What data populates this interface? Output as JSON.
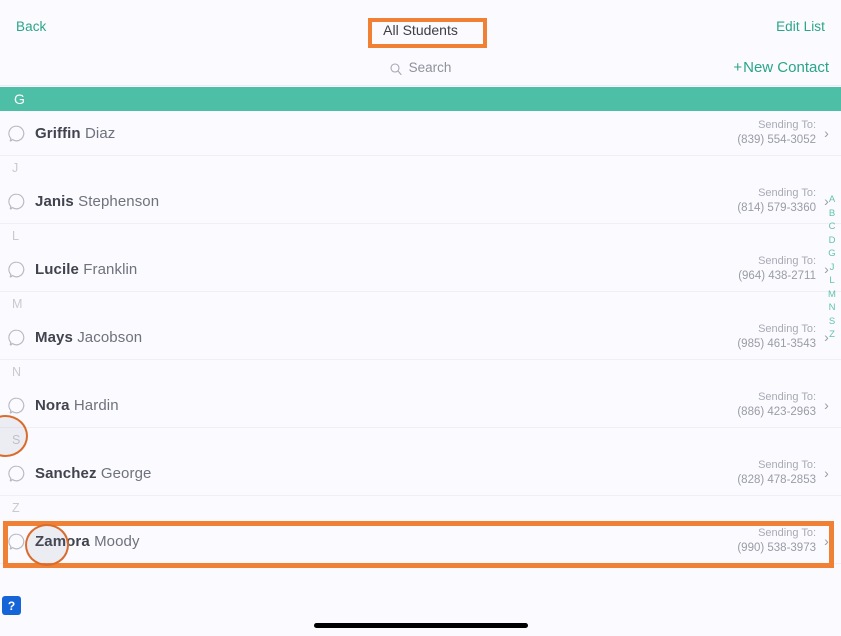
{
  "navbar": {
    "back_label": "Back",
    "title": "All Students",
    "edit_label": "Edit List"
  },
  "search": {
    "placeholder": "Search",
    "icon": "search-icon",
    "new_contact_plus": "+",
    "new_contact_label": "New Contact"
  },
  "list": {
    "band_letter": "G",
    "sending_label": "Sending To:",
    "chevron": "›",
    "rows": [
      {
        "type": "contact",
        "first": "Griffin",
        "last": " Diaz",
        "sending_label": "Sending To:",
        "phone": "(839) 554-3052"
      },
      {
        "type": "letter",
        "letter": "J"
      },
      {
        "type": "contact",
        "first": "Janis",
        "last": " Stephenson",
        "sending_label": "Sending To:",
        "phone": "(814) 579-3360"
      },
      {
        "type": "letter",
        "letter": "L"
      },
      {
        "type": "contact",
        "first": "Lucile",
        "last": " Franklin",
        "sending_label": "Sending To:",
        "phone": "(964) 438-2711"
      },
      {
        "type": "letter",
        "letter": "M"
      },
      {
        "type": "contact",
        "first": "Mays",
        "last": " Jacobson",
        "sending_label": "Sending To:",
        "phone": "(985) 461-3543"
      },
      {
        "type": "letter",
        "letter": "N"
      },
      {
        "type": "contact",
        "first": "Nora",
        "last": " Hardin",
        "sending_label": "Sending To:",
        "phone": "(886) 423-2963"
      },
      {
        "type": "letter",
        "letter": "S"
      },
      {
        "type": "contact",
        "first": "Sanchez",
        "last": " George",
        "sending_label": "Sending To:",
        "phone": "(828) 478-2853"
      },
      {
        "type": "letter",
        "letter": "Z"
      },
      {
        "type": "contact",
        "first": "Zamora",
        "last": " Moody",
        "sending_label": "Sending To:",
        "phone": "(990) 538-3973"
      }
    ]
  },
  "alpha_index": [
    "A",
    "B",
    "C",
    "D",
    "G",
    "J",
    "L",
    "M",
    "N",
    "S",
    "Z"
  ],
  "help": {
    "label": "?"
  },
  "colors": {
    "accent_teal": "#2aa58a",
    "band_teal": "#4cbfa6",
    "index_teal": "#63c3ae",
    "annotation_orange": "#f08033",
    "annotation_circle": "#d96c2c",
    "help_blue": "#1565d8",
    "background": "#fafaff"
  }
}
